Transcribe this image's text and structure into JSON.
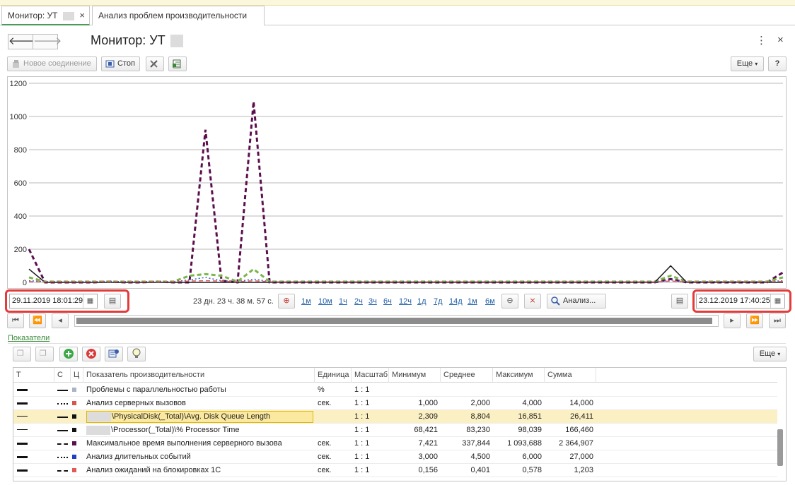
{
  "tabs": [
    {
      "label": "Монитор: УТ",
      "active": true
    },
    {
      "label": "Анализ проблем производительности",
      "active": false
    }
  ],
  "window": {
    "title": "Монитор: УТ",
    "back_icon": "arrow-left-icon",
    "forward_icon": "arrow-right-icon",
    "menu_icon": "⋮",
    "close_icon": "×"
  },
  "toolbar": {
    "new_connection": "Новое соединение",
    "stop": "Стоп",
    "more": "Еще",
    "help": "?"
  },
  "chart_data": {
    "type": "line",
    "ylim": [
      0,
      1200
    ],
    "y_ticks": [
      "1200",
      "1000",
      "800",
      "600",
      "400",
      "200",
      "0"
    ],
    "x_count": 48,
    "grid": true,
    "series": [
      {
        "color": "#5c0f4e",
        "dash": "dashed",
        "values": [
          200,
          0,
          0,
          0,
          0,
          5,
          0,
          0,
          5,
          0,
          0,
          920,
          10,
          0,
          1090,
          0,
          0,
          0,
          0,
          0,
          0,
          0,
          0,
          0,
          0,
          0,
          0,
          0,
          0,
          0,
          0,
          0,
          0,
          0,
          0,
          0,
          0,
          0,
          0,
          0,
          20,
          0,
          0,
          0,
          0,
          0,
          0,
          60
        ]
      },
      {
        "color": "#7ab648",
        "dash": "dashed",
        "values": [
          30,
          5,
          5,
          5,
          5,
          5,
          5,
          5,
          5,
          5,
          40,
          50,
          40,
          5,
          80,
          5,
          5,
          5,
          5,
          5,
          5,
          5,
          5,
          5,
          5,
          5,
          5,
          5,
          5,
          5,
          5,
          5,
          5,
          5,
          5,
          5,
          5,
          5,
          5,
          5,
          40,
          5,
          5,
          5,
          5,
          5,
          5,
          30
        ]
      },
      {
        "color": "#1a1a1a",
        "dash": "solid",
        "values": [
          80,
          0,
          0,
          0,
          0,
          0,
          0,
          0,
          0,
          0,
          0,
          0,
          0,
          0,
          0,
          0,
          0,
          0,
          0,
          0,
          0,
          0,
          0,
          0,
          0,
          0,
          0,
          0,
          0,
          0,
          0,
          0,
          0,
          0,
          0,
          0,
          0,
          0,
          0,
          0,
          100,
          0,
          0,
          0,
          0,
          0,
          0,
          0
        ]
      },
      {
        "color": "#3a5fcd",
        "dash": "dotted",
        "values": [
          10,
          5,
          5,
          5,
          5,
          5,
          5,
          5,
          5,
          5,
          15,
          30,
          10,
          5,
          20,
          5,
          5,
          5,
          5,
          5,
          5,
          5,
          5,
          5,
          5,
          5,
          5,
          5,
          5,
          5,
          5,
          5,
          5,
          5,
          5,
          5,
          5,
          5,
          5,
          5,
          15,
          5,
          5,
          5,
          5,
          5,
          5,
          10
        ]
      },
      {
        "color": "#e05a5a",
        "dash": "dashed",
        "values": [
          5,
          3,
          3,
          3,
          3,
          3,
          3,
          3,
          3,
          3,
          8,
          10,
          8,
          3,
          10,
          3,
          3,
          3,
          3,
          3,
          3,
          3,
          3,
          3,
          3,
          3,
          3,
          3,
          3,
          3,
          3,
          3,
          3,
          3,
          3,
          3,
          3,
          3,
          3,
          3,
          8,
          3,
          3,
          3,
          3,
          3,
          3,
          5
        ]
      }
    ]
  },
  "period": {
    "start": "29.11.2019 18:01:29",
    "end": "23.12.2019 17:40:25",
    "duration": "23 дн. 23 ч. 38 м. 57 с.",
    "scales": [
      "1м",
      "10м",
      "1ч",
      "2ч",
      "3ч",
      "6ч",
      "12ч",
      "1д",
      "7д",
      "14д",
      "1м",
      "6м"
    ],
    "analyze_label": "Анализ...",
    "accent": "#e53a3a"
  },
  "indicators": {
    "section_label": "Показатели",
    "more": "Еще",
    "columns": [
      "Т",
      "С",
      "Ц",
      "Показатель производительности",
      "Единица",
      "Масштаб",
      "Минимум",
      "Среднее",
      "Максимум",
      "Сумма"
    ],
    "rows": [
      {
        "name": "Проблемы с параллельностью работы",
        "unit": "%",
        "scale": "1 : 1",
        "min": "",
        "avg": "",
        "max": "",
        "sum": "",
        "color": "#a8b4c8",
        "style": "solid",
        "weight": "bold"
      },
      {
        "name": "Анализ серверных вызовов",
        "unit": "сек.",
        "scale": "1 : 1",
        "min": "1,000",
        "avg": "2,000",
        "max": "4,000",
        "sum": "14,000",
        "color": "#d9534f",
        "style": "dotted",
        "weight": "bold"
      },
      {
        "name": "\\PhysicalDisk(_Total)\\Avg. Disk Queue Length",
        "unit": "",
        "scale": "1 : 1",
        "min": "2,309",
        "avg": "8,804",
        "max": "16,851",
        "sum": "26,411",
        "color": "#111111",
        "style": "solid",
        "weight": "thin",
        "selected": true
      },
      {
        "name": "\\Processor(_Total)\\% Processor Time",
        "unit": "",
        "scale": "1 : 1",
        "min": "68,421",
        "avg": "83,230",
        "max": "98,039",
        "sum": "166,460",
        "color": "#111111",
        "style": "solid",
        "weight": "thin"
      },
      {
        "name": "Максимальное время выполнения серверного вызова",
        "unit": "сек.",
        "scale": "1 : 1",
        "min": "7,421",
        "avg": "337,844",
        "max": "1 093,688",
        "sum": "2 364,907",
        "color": "#5c0f4e",
        "style": "dashed",
        "weight": "bold"
      },
      {
        "name": "Анализ длительных событий",
        "unit": "сек.",
        "scale": "1 : 1",
        "min": "3,000",
        "avg": "4,500",
        "max": "6,000",
        "sum": "27,000",
        "color": "#2040c0",
        "style": "dotted",
        "weight": "bold"
      },
      {
        "name": "Анализ ожиданий на блокировках 1С",
        "unit": "сек.",
        "scale": "1 : 1",
        "min": "0,156",
        "avg": "0,401",
        "max": "0,578",
        "sum": "1,203",
        "color": "#e05a5a",
        "style": "dashed",
        "weight": "bold"
      }
    ]
  }
}
